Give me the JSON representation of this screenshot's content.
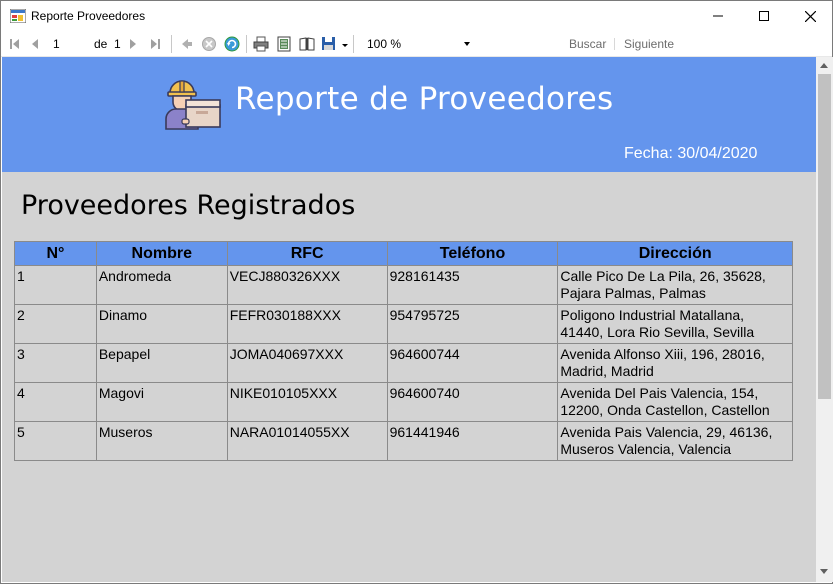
{
  "window": {
    "title": "Reporte Proveedores"
  },
  "toolbar": {
    "page_current": "1",
    "page_of_label": "de",
    "page_total": "1",
    "zoom": "100 %",
    "search_label": "Buscar",
    "next_label": "Siguiente"
  },
  "report": {
    "title": "Reporte de Proveedores",
    "date": "Fecha: 30/04/2020",
    "section_title": "Proveedores Registrados",
    "columns": [
      "N°",
      "Nombre",
      "RFC",
      "Teléfono",
      "Dirección"
    ],
    "rows": [
      {
        "n": "1",
        "nombre": "Andromeda",
        "rfc": "VECJ880326XXX",
        "telefono": "928161435",
        "direccion": "Calle Pico De La Pila, 26, 35628, Pajara Palmas, Palmas"
      },
      {
        "n": "2",
        "nombre": "Dinamo",
        "rfc": "FEFR030188XXX",
        "telefono": "954795725",
        "direccion": "Poligono Industrial Matallana, 41440, Lora Rio Sevilla, Sevilla"
      },
      {
        "n": "3",
        "nombre": "Bepapel",
        "rfc": "JOMA040697XXX",
        "telefono": "964600744",
        "direccion": "Avenida Alfonso Xiii, 196, 28016, Madrid, Madrid"
      },
      {
        "n": "4",
        "nombre": "Magovi",
        "rfc": "NIKE010105XXX",
        "telefono": "964600740",
        "direccion": "Avenida Del Pais Valencia, 154, 12200, Onda Castellon, Castellon"
      },
      {
        "n": "5",
        "nombre": "Museros",
        "rfc": "NARA01014055XX",
        "telefono": "961441946",
        "direccion": "Avenida Pais Valencia, 29, 46136, Museros Valencia, Valencia"
      }
    ]
  },
  "colors": {
    "banner": "#6495ed",
    "content_bg": "#d3d3d3"
  }
}
